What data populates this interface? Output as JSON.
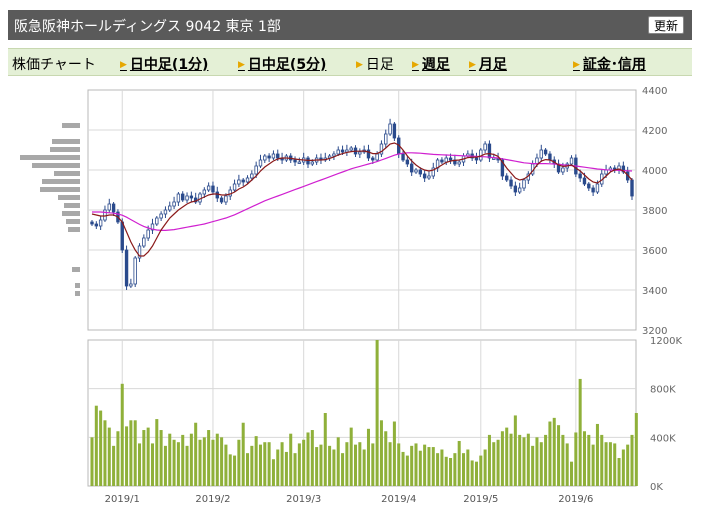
{
  "header": {
    "title": "阪急阪神ホールディングス  9042  東京 1部",
    "refresh_label": "更新"
  },
  "nav": {
    "label": "株価チャート",
    "items": [
      {
        "label": "日中足(1分)",
        "link": true
      },
      {
        "label": "日中足(5分)",
        "link": true
      },
      {
        "label": "日足",
        "link": false
      },
      {
        "label": "週足",
        "link": true
      },
      {
        "label": "月足",
        "link": true
      },
      {
        "label": "証金･信用",
        "link": true
      }
    ]
  },
  "colors": {
    "candle": "#2a4a8c",
    "ma_short": "#8b1a1a",
    "ma_long": "#d020d0",
    "volume_bar": "#8fb03a",
    "grid": "#d8d8d8",
    "profile_bar": "#a8a8a8"
  },
  "chart_data": [
    {
      "type": "candlestick",
      "yticks": [
        3200,
        3400,
        3600,
        3800,
        4000,
        4200,
        4400
      ],
      "ylim": [
        3200,
        4400
      ],
      "xticks": [
        "2019/1",
        "2019/2",
        "2019/3",
        "2019/4",
        "2019/5",
        "2019/6"
      ],
      "tick_index": [
        7,
        28,
        49,
        71,
        90,
        112
      ],
      "close": [
        3730,
        3720,
        3750,
        3800,
        3830,
        3790,
        3740,
        3600,
        3420,
        3430,
        3560,
        3620,
        3660,
        3700,
        3730,
        3760,
        3780,
        3800,
        3820,
        3840,
        3880,
        3850,
        3870,
        3860,
        3840,
        3880,
        3900,
        3920,
        3890,
        3860,
        3840,
        3870,
        3900,
        3930,
        3950,
        3940,
        3960,
        3980,
        4020,
        4050,
        4070,
        4060,
        4080,
        4060,
        4050,
        4070,
        4050,
        4040,
        4040,
        4060,
        4030,
        4040,
        4060,
        4050,
        4060,
        4070,
        4080,
        4100,
        4090,
        4100,
        4110,
        4080,
        4090,
        4100,
        4060,
        4050,
        4080,
        4130,
        4180,
        4230,
        4160,
        4080,
        4050,
        4030,
        3990,
        4000,
        3980,
        3960,
        3970,
        4010,
        4050,
        4040,
        4060,
        4050,
        4030,
        4040,
        4070,
        4080,
        4060,
        4050,
        4100,
        4130,
        4060,
        4060,
        4050,
        3970,
        3950,
        3920,
        3890,
        3910,
        3950,
        3980,
        4030,
        4060,
        4100,
        4080,
        4050,
        4030,
        3990,
        4010,
        4030,
        4060,
        3980,
        3960,
        3930,
        3910,
        3890,
        3930,
        3980,
        4000,
        4010,
        4000,
        4020,
        3990,
        3950,
        3870
      ],
      "ma_short": [
        3780,
        3775,
        3770,
        3770,
        3775,
        3775,
        3765,
        3740,
        3690,
        3640,
        3600,
        3570,
        3570,
        3590,
        3620,
        3660,
        3700,
        3730,
        3760,
        3780,
        3800,
        3815,
        3830,
        3840,
        3845,
        3855,
        3865,
        3875,
        3880,
        3880,
        3875,
        3875,
        3880,
        3890,
        3905,
        3915,
        3930,
        3950,
        3970,
        3995,
        4015,
        4030,
        4045,
        4055,
        4060,
        4060,
        4058,
        4055,
        4052,
        4050,
        4048,
        4048,
        4050,
        4050,
        4052,
        4058,
        4065,
        4075,
        4082,
        4088,
        4092,
        4094,
        4094,
        4095,
        4090,
        4082,
        4082,
        4092,
        4110,
        4130,
        4135,
        4125,
        4100,
        4070,
        4045,
        4025,
        4010,
        4000,
        3995,
        4000,
        4012,
        4025,
        4038,
        4045,
        4048,
        4050,
        4055,
        4062,
        4064,
        4064,
        4070,
        4080,
        4082,
        4078,
        4068,
        4040,
        4010,
        3985,
        3960,
        3950,
        3955,
        3970,
        3995,
        4025,
        4045,
        4052,
        4050,
        4040,
        4025,
        4018,
        4020,
        4025,
        4010,
        3995,
        3975,
        3955,
        3940,
        3935,
        3950,
        3970,
        3990,
        4000,
        4005,
        3995,
        3975,
        3950
      ],
      "ma_long": [
        3790,
        3790,
        3790,
        3788,
        3786,
        3784,
        3780,
        3774,
        3764,
        3752,
        3740,
        3728,
        3718,
        3710,
        3704,
        3700,
        3698,
        3698,
        3700,
        3702,
        3706,
        3710,
        3714,
        3718,
        3722,
        3726,
        3730,
        3736,
        3742,
        3748,
        3754,
        3760,
        3768,
        3776,
        3786,
        3796,
        3806,
        3816,
        3826,
        3836,
        3846,
        3854,
        3862,
        3870,
        3878,
        3886,
        3894,
        3902,
        3910,
        3918,
        3926,
        3934,
        3942,
        3950,
        3958,
        3966,
        3974,
        3982,
        3990,
        3998,
        4006,
        4012,
        4018,
        4024,
        4030,
        4036,
        4042,
        4050,
        4058,
        4066,
        4074,
        4080,
        4084,
        4086,
        4086,
        4085,
        4084,
        4082,
        4080,
        4078,
        4077,
        4076,
        4075,
        4074,
        4073,
        4072,
        4071,
        4070,
        4069,
        4068,
        4067,
        4066,
        4064,
        4062,
        4060,
        4056,
        4052,
        4048,
        4044,
        4040,
        4036,
        4034,
        4032,
        4032,
        4032,
        4032,
        4031,
        4030,
        4028,
        4026,
        4024,
        4022,
        4020,
        4017,
        4014,
        4011,
        4008,
        4005,
        4003,
        4001,
        4000,
        3999,
        3998,
        3997,
        3996,
        3995
      ],
      "volume_profile": [
        {
          "price": 4220,
          "length": 18
        },
        {
          "price": 4140,
          "length": 28
        },
        {
          "price": 4100,
          "length": 30
        },
        {
          "price": 4060,
          "length": 60
        },
        {
          "price": 4020,
          "length": 48
        },
        {
          "price": 3980,
          "length": 26
        },
        {
          "price": 3940,
          "length": 38
        },
        {
          "price": 3900,
          "length": 40
        },
        {
          "price": 3860,
          "length": 22
        },
        {
          "price": 3820,
          "length": 16
        },
        {
          "price": 3780,
          "length": 18
        },
        {
          "price": 3740,
          "length": 14
        },
        {
          "price": 3700,
          "length": 12
        },
        {
          "price": 3500,
          "length": 8
        },
        {
          "price": 3420,
          "length": 5
        },
        {
          "price": 3380,
          "length": 5
        }
      ]
    },
    {
      "type": "bar",
      "yticks": [
        "0K",
        "400K",
        "800K",
        "1200K"
      ],
      "ylim": [
        0,
        1200000
      ],
      "xticks": [
        "2019/1",
        "2019/2",
        "2019/3",
        "2019/4",
        "2019/5",
        "2019/6"
      ],
      "values": [
        400000,
        660000,
        620000,
        540000,
        480000,
        330000,
        450000,
        840000,
        490000,
        540000,
        540000,
        350000,
        460000,
        480000,
        350000,
        550000,
        460000,
        330000,
        430000,
        380000,
        360000,
        420000,
        330000,
        430000,
        520000,
        380000,
        400000,
        460000,
        380000,
        430000,
        400000,
        340000,
        260000,
        250000,
        380000,
        520000,
        270000,
        330000,
        410000,
        340000,
        360000,
        360000,
        220000,
        300000,
        360000,
        280000,
        430000,
        270000,
        350000,
        380000,
        440000,
        460000,
        320000,
        340000,
        600000,
        330000,
        300000,
        400000,
        270000,
        360000,
        480000,
        340000,
        360000,
        300000,
        470000,
        350000,
        1200000,
        540000,
        450000,
        360000,
        530000,
        350000,
        280000,
        250000,
        330000,
        350000,
        290000,
        340000,
        320000,
        320000,
        270000,
        300000,
        240000,
        230000,
        270000,
        370000,
        270000,
        300000,
        210000,
        200000,
        250000,
        300000,
        420000,
        360000,
        380000,
        450000,
        480000,
        430000,
        580000,
        420000,
        400000,
        430000,
        330000,
        400000,
        360000,
        420000,
        530000,
        560000,
        500000,
        420000,
        350000,
        200000,
        440000,
        880000,
        450000,
        420000,
        340000,
        510000,
        420000,
        360000,
        360000,
        350000,
        230000,
        300000,
        340000,
        420000,
        600000
      ]
    }
  ]
}
